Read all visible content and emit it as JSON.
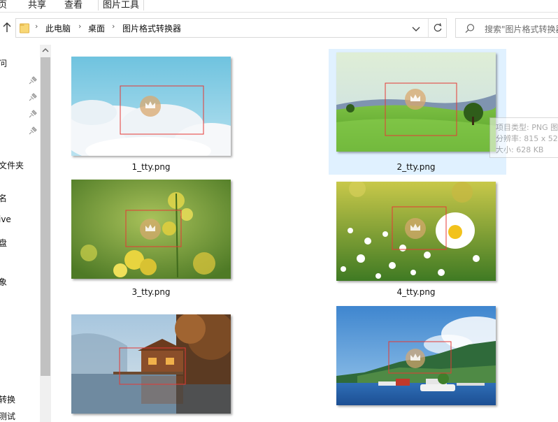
{
  "ribbon": {
    "tabs": [
      "页",
      "共享",
      "查看",
      "图片工具"
    ]
  },
  "address": {
    "crumbs": [
      "此电脑",
      "桌面",
      "图片格式转换器"
    ]
  },
  "search": {
    "placeholder": "搜索\"图片格式转换器"
  },
  "nav": {
    "items": [
      "问",
      "文件夹",
      "名",
      "ive",
      "盘",
      "象",
      "转换",
      "测试"
    ]
  },
  "files": [
    {
      "name": "1_tty.png",
      "selected": false
    },
    {
      "name": "2_tty.png",
      "selected": true
    },
    {
      "name": "3_tty.png",
      "selected": false
    },
    {
      "name": "4_tty.png",
      "selected": false
    },
    {
      "name": "",
      "selected": false
    },
    {
      "name": "",
      "selected": false
    }
  ],
  "tooltip": {
    "type": "项目类型: PNG 图",
    "resolution": "分辨率: 815 x 52",
    "size": "大小: 628 KB"
  },
  "colors": {
    "selection": "#cce8ff",
    "annotation_box": "#e53935"
  }
}
